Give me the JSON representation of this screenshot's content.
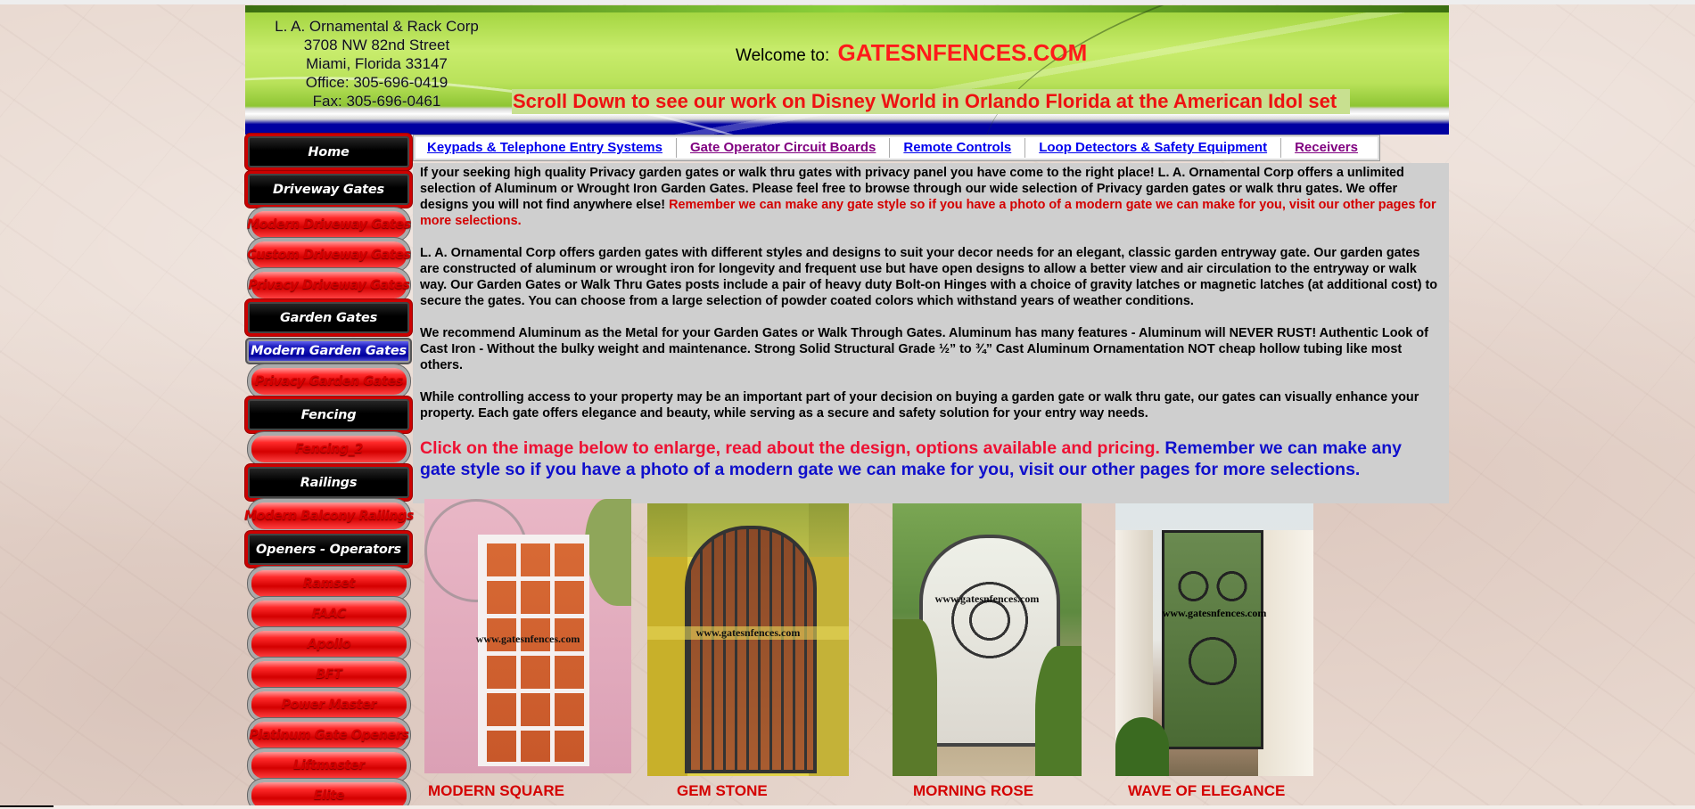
{
  "header": {
    "address": [
      "L. A. Ornamental & Rack Corp",
      "3708 NW 82nd Street",
      "Miami, Florida 33147",
      "Office: 305-696-0419",
      "Fax: 305-696-0461"
    ],
    "welcome_label": "Welcome to:",
    "site_name": "GATESNFENCES.COM",
    "scroll_message": "Scroll Down to see our work on Disney World in Orlando Florida at the American Idol set"
  },
  "sidebar": {
    "items": [
      {
        "label": "Home",
        "style": "black"
      },
      {
        "label": "Driveway Gates",
        "style": "black"
      },
      {
        "label": "Modern Driveway Gates",
        "style": "red"
      },
      {
        "label": "Custom Driveway Gates",
        "style": "red"
      },
      {
        "label": "Privacy Driveway Gates",
        "style": "red"
      },
      {
        "label": "Garden Gates",
        "style": "black"
      },
      {
        "label": "Modern Garden Gates",
        "style": "blue"
      },
      {
        "label": "Privacy Garden Gates",
        "style": "red"
      },
      {
        "label": "Fencing",
        "style": "black"
      },
      {
        "label": "Fencing_2",
        "style": "red"
      },
      {
        "label": "Railings",
        "style": "black"
      },
      {
        "label": "Modern Balcony Railings",
        "style": "red"
      },
      {
        "label": "Openers - Operators",
        "style": "black"
      },
      {
        "label": "Ramset",
        "style": "red"
      },
      {
        "label": "FAAC",
        "style": "red"
      },
      {
        "label": "Apollo",
        "style": "red"
      },
      {
        "label": "BFT",
        "style": "red"
      },
      {
        "label": "Power Master",
        "style": "red"
      },
      {
        "label": "Platinum Gate Openers",
        "style": "red"
      },
      {
        "label": "Liftmaster",
        "style": "red"
      },
      {
        "label": "Elite",
        "style": "red"
      }
    ]
  },
  "tabs": [
    {
      "label": "Keypads & Telephone Entry Systems",
      "visited": false
    },
    {
      "label": "Gate Operator Circuit Boards",
      "visited": true
    },
    {
      "label": "Remote Controls",
      "visited": false
    },
    {
      "label": "Loop Detectors & Safety Equipment",
      "visited": false
    },
    {
      "label": "Receivers",
      "visited": true
    }
  ],
  "content": {
    "p1_black": "If your seeking high quality Privacy garden gates or walk thru gates with privacy panel you have come to the right place!  L. A. Ornamental Corp offers a unlimited selection of Aluminum or Wrought Iron Garden Gates. Please feel free to browse through our wide selection of Privacy garden gates or walk thru gates. We offer designs you will not find anywhere else! ",
    "p1_red": "Remember we can make any gate style so if you have a photo of a modern gate we can make for you, visit our other pages for more selections.",
    "p2": "L. A. Ornamental Corp offers garden gates with different styles and designs to suit your decor needs for an elegant, classic garden entryway gate. Our garden gates are constructed of aluminum or wrought iron for longevity and frequent use but have open designs to allow a better view and air circulation to the entryway or walk way. Our Garden Gates or Walk Thru Gates posts include a pair of heavy duty Bolt-on Hinges with a choice of gravity latches or magnetic latches (at additional cost) to secure the gates. You can choose from a large selection of powder coated colors which withstand years of weather conditions.",
    "p3": "We recommend Aluminum as the Metal for your Garden Gates or Walk Through Gates. Aluminum has many features - Aluminum will NEVER RUST!  Authentic Look of Cast Iron - Without the bulky weight and maintenance. Strong Solid Structural Grade ½” to ¾” Cast Aluminum Ornamentation NOT cheap hollow tubing like most others.",
    "p4": "While controlling access to your property may be an important part of your decision on buying a garden gate or walk thru gate, our gates can visually enhance your property. Each gate offers elegance and beauty, while serving as a secure and safety solution for your entry way needs.",
    "cta_red": "Click on the image below to enlarge, read about the design, options available and pricing. ",
    "cta_blue": "Remember we can make any gate style so if you have a photo of a modern gate we can make for you, visit our other pages for more selections."
  },
  "gallery": [
    {
      "caption": "MODERN SQUARE",
      "watermark": "www.gatesnfences.com"
    },
    {
      "caption": "GEM STONE",
      "watermark": "www.gatesnfences.com"
    },
    {
      "caption": "MORNING ROSE",
      "watermark": "www.gatesnfences.com"
    },
    {
      "caption": "WAVE OF ELEGANCE",
      "watermark": "www.gatesnfences.com"
    }
  ]
}
